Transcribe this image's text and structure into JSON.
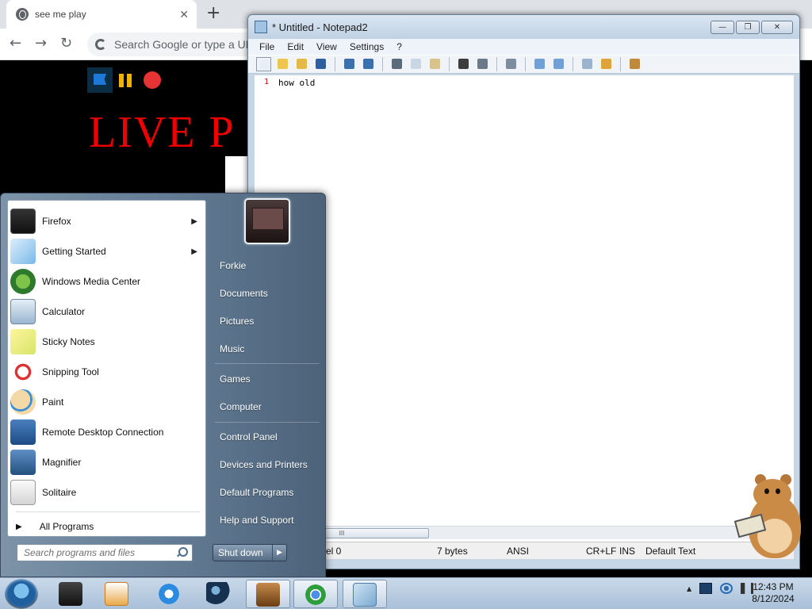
{
  "browser": {
    "tab_title": "see me play",
    "tab_close": "✕",
    "new_tab": "+",
    "omnibox_placeholder": "Search Google or type a URL",
    "page": {
      "banner_text": "LIVE P"
    }
  },
  "notepad": {
    "title": "* Untitled - Notepad2",
    "menu": [
      "File",
      "Edit",
      "View",
      "Settings",
      "?"
    ],
    "line_number": "1",
    "content": "how old",
    "hscroll_grip": "III",
    "status": {
      "position": "el 0",
      "size": "7 bytes",
      "encoding": "ANSI",
      "eol": "CR+LF",
      "mode": "INS",
      "scheme": "Default Text"
    },
    "caption": {
      "minimize": "—",
      "maximize": "❐",
      "close": "✕"
    }
  },
  "start_menu": {
    "programs": [
      {
        "label": "Firefox",
        "icon": "firefox-icon",
        "submenu": true
      },
      {
        "label": "Getting Started",
        "icon": "getting-started-icon",
        "submenu": true
      },
      {
        "label": "Windows Media Center",
        "icon": "media-center-icon",
        "submenu": false
      },
      {
        "label": "Calculator",
        "icon": "calculator-icon",
        "submenu": false
      },
      {
        "label": "Sticky Notes",
        "icon": "sticky-notes-icon",
        "submenu": false
      },
      {
        "label": "Snipping Tool",
        "icon": "snipping-tool-icon",
        "submenu": false
      },
      {
        "label": "Paint",
        "icon": "paint-icon",
        "submenu": false
      },
      {
        "label": "Remote Desktop Connection",
        "icon": "remote-desktop-icon",
        "submenu": false
      },
      {
        "label": "Magnifier",
        "icon": "magnifier-icon",
        "submenu": false
      },
      {
        "label": "Solitaire",
        "icon": "solitaire-icon",
        "submenu": false
      }
    ],
    "all_programs": "All Programs",
    "search_placeholder": "Search programs and files",
    "links": {
      "user": "Forkie",
      "documents": "Documents",
      "pictures": "Pictures",
      "music": "Music",
      "games": "Games",
      "computer": "Computer",
      "control_panel": "Control Panel",
      "devices": "Devices and Printers",
      "default_programs": "Default Programs",
      "help": "Help and Support"
    },
    "shutdown": "Shut down",
    "shutdown_arrow": "▶"
  },
  "taskbar": {
    "time": "12:43 PM",
    "date": "8/12/2024",
    "tray_expand": "▲"
  },
  "colors": {
    "start_menu_accent": "#5f7890",
    "taskbar": "#b7cbe0",
    "live_text": "#e00000"
  }
}
